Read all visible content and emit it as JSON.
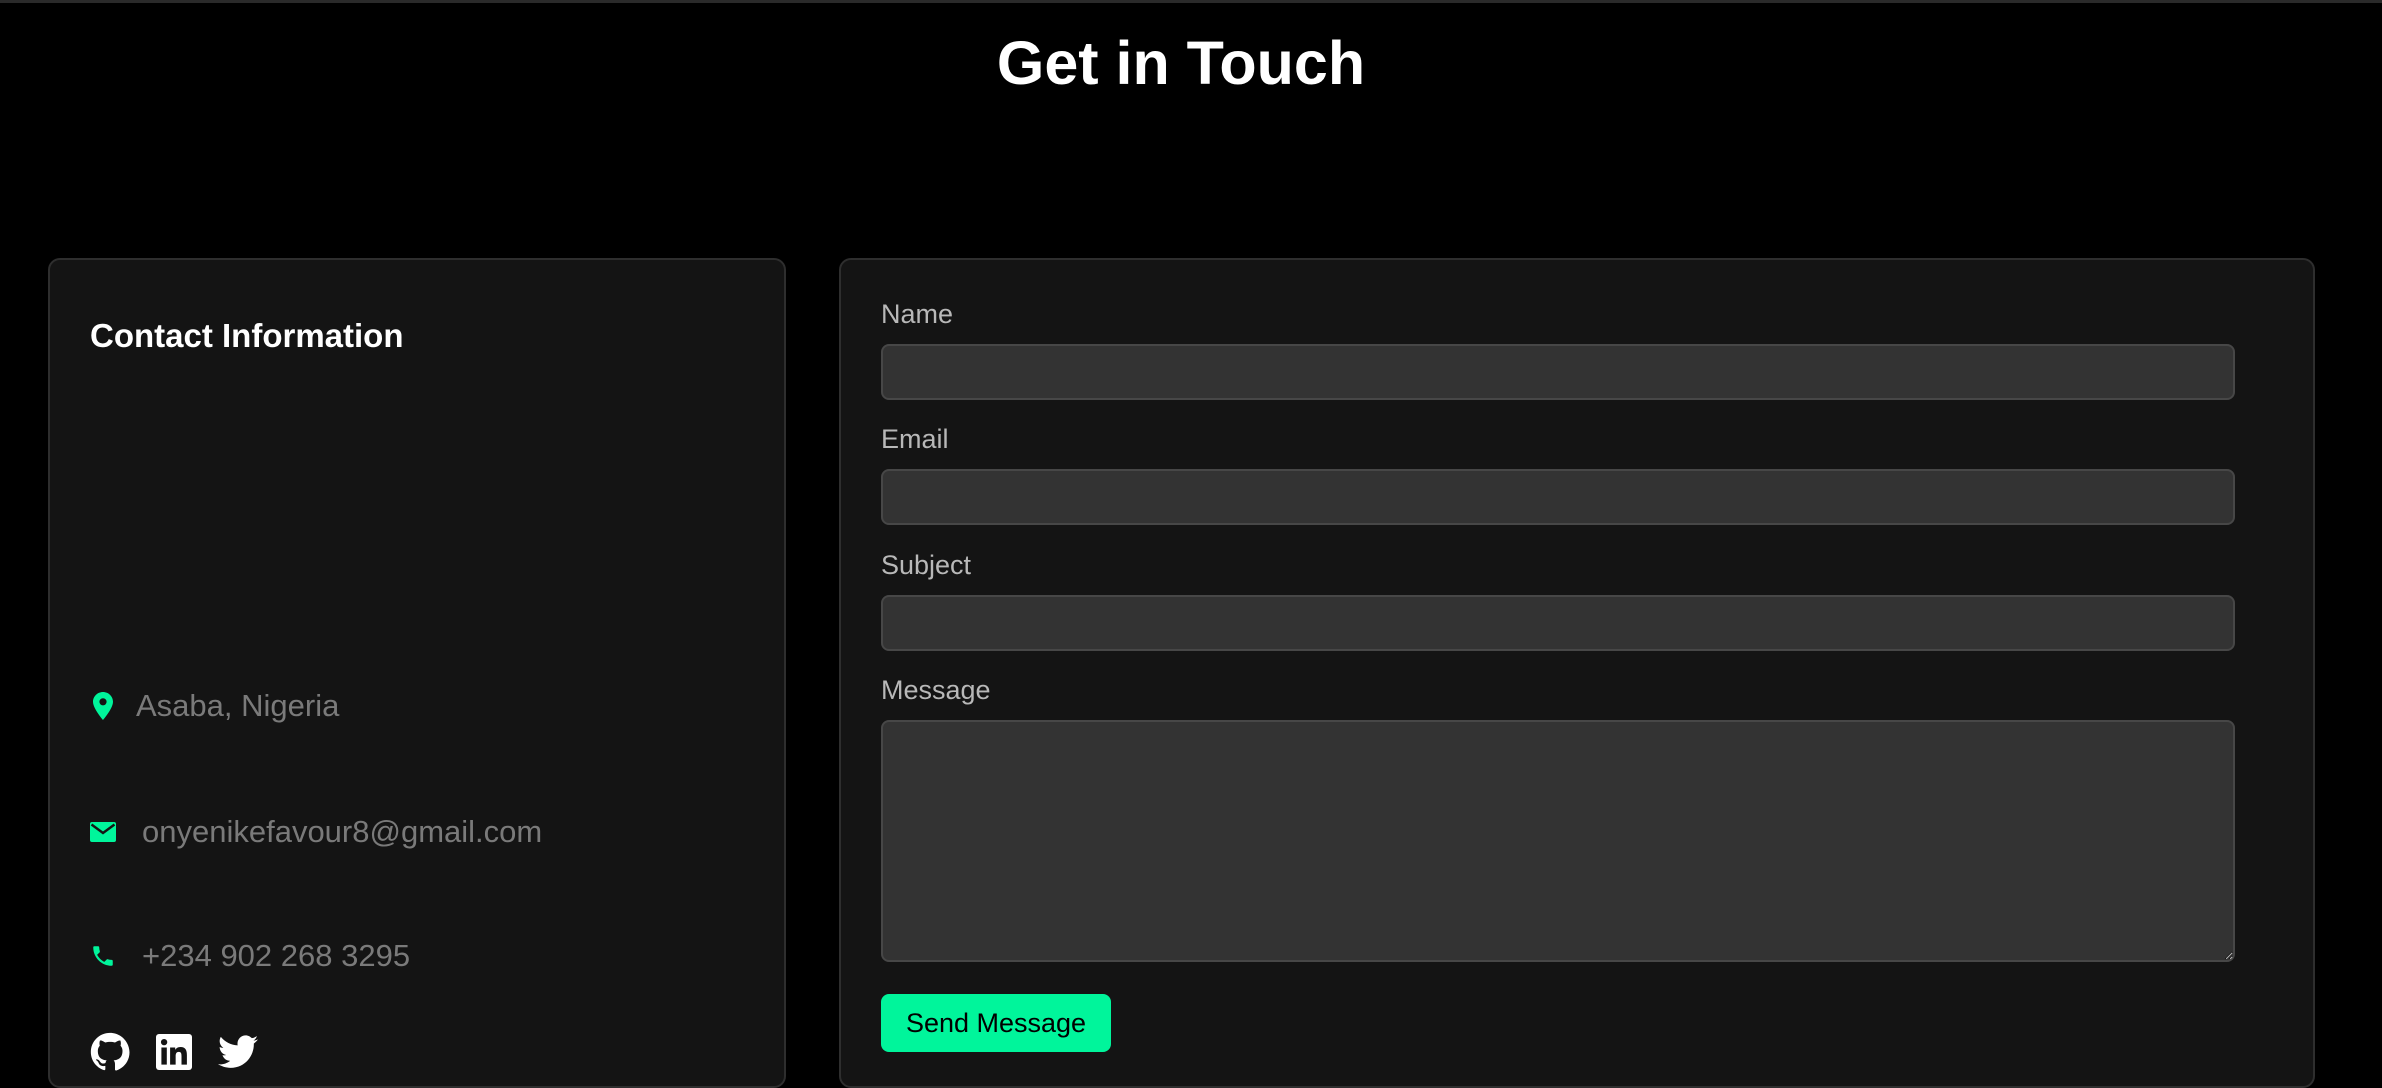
{
  "page": {
    "title": "Get in Touch"
  },
  "contact_info": {
    "heading": "Contact Information",
    "location": {
      "icon": "map-pin-icon",
      "text": "Asaba, Nigeria"
    },
    "email": {
      "icon": "envelope-icon",
      "text": "onyenikefavour8@gmail.com"
    },
    "phone": {
      "icon": "phone-icon",
      "text": "+234 902 268 3295"
    },
    "socials": [
      {
        "icon": "github-icon"
      },
      {
        "icon": "linkedin-icon"
      },
      {
        "icon": "twitter-icon"
      }
    ]
  },
  "form": {
    "name_label": "Name",
    "name_value": "",
    "email_label": "Email",
    "email_value": "",
    "subject_label": "Subject",
    "subject_value": "",
    "message_label": "Message",
    "message_value": "",
    "submit_label": "Send Message"
  },
  "colors": {
    "accent": "#00f59b",
    "background": "#000000",
    "card": "#141414",
    "input": "#333333",
    "muted_text": "#7a7a7a"
  }
}
